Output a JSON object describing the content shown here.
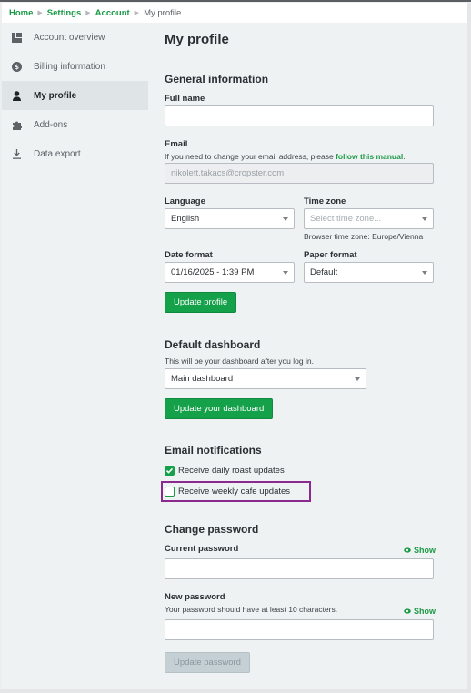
{
  "breadcrumb": {
    "items": [
      {
        "label": "Home"
      },
      {
        "label": "Settings"
      },
      {
        "label": "Account"
      }
    ],
    "current": "My profile"
  },
  "sidebar": {
    "items": [
      {
        "label": "Account overview",
        "icon": "dashboard-icon",
        "active": false
      },
      {
        "label": "Billing information",
        "icon": "dollar-coin-icon",
        "active": false
      },
      {
        "label": "My profile",
        "icon": "user-icon",
        "active": true
      },
      {
        "label": "Add-ons",
        "icon": "puzzle-icon",
        "active": false
      },
      {
        "label": "Data export",
        "icon": "download-icon",
        "active": false
      }
    ]
  },
  "page": {
    "title": "My profile"
  },
  "general": {
    "heading": "General information",
    "full_name": {
      "label": "Full name",
      "value": ""
    },
    "email": {
      "label": "Email",
      "hint_prefix": "If you need to change your email address, please ",
      "hint_link": "follow this manual",
      "hint_suffix": ".",
      "value": "nikolett.takacs@cropster.com"
    },
    "language": {
      "label": "Language",
      "value": "English"
    },
    "time_zone": {
      "label": "Time zone",
      "placeholder": "Select time zone...",
      "hint": "Browser time zone: Europe/Vienna"
    },
    "date_format": {
      "label": "Date format",
      "value": "01/16/2025 - 1:39 PM"
    },
    "paper_format": {
      "label": "Paper format",
      "value": "Default"
    },
    "update_button": "Update profile"
  },
  "dashboard": {
    "heading": "Default dashboard",
    "hint": "This will be your dashboard after you log in.",
    "value": "Main dashboard",
    "update_button": "Update your dashboard"
  },
  "notifications": {
    "heading": "Email notifications",
    "options": [
      {
        "label": "Receive daily roast updates",
        "checked": true
      },
      {
        "label": "Receive weekly cafe updates",
        "checked": false
      }
    ]
  },
  "password": {
    "heading": "Change password",
    "current": {
      "label": "Current password",
      "show_label": "Show",
      "value": ""
    },
    "new": {
      "label": "New password",
      "hint": "Your password should have at least 10 characters.",
      "show_label": "Show",
      "value": ""
    },
    "update_button": "Update password"
  },
  "colors": {
    "accent": "#14a14a",
    "link": "#1a9a45",
    "focus": "#8a2a8f",
    "disabled_button": "#c5d0d5"
  }
}
